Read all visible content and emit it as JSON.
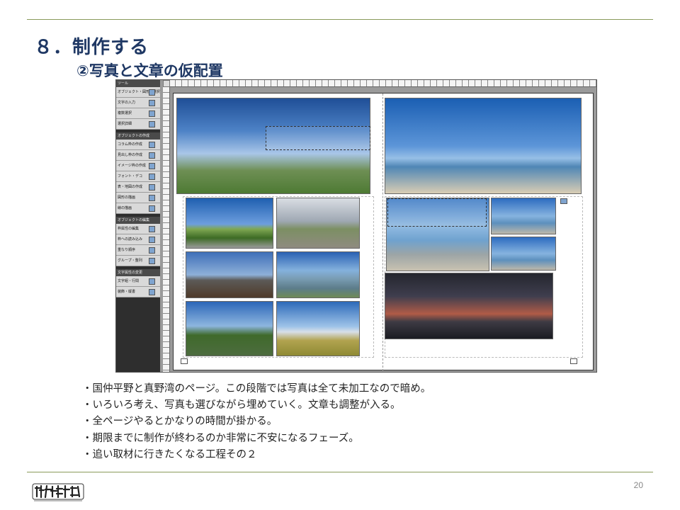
{
  "slide": {
    "title": "８．制作する",
    "subtitle": "②写真と文章の仮配置",
    "page_number": "20"
  },
  "colors": {
    "title": "#1f3864",
    "rule": "#8a9a5b",
    "text": "#222222"
  },
  "app_panel": {
    "sections": [
      {
        "header": "ツール",
        "items": [
          "オブジェクト・図形の選択",
          "文字の入力",
          "複数選択",
          "選択詳細"
        ]
      },
      {
        "header": "オブジェクトの作成",
        "items": [
          "コラム枠の作成",
          "見出し枠の作成",
          "イメージ枠の作成",
          "フォント・デコ",
          "表・地図の作成",
          "図形の描画",
          "線の描画"
        ]
      },
      {
        "header": "オブジェクトの編集",
        "items": [
          "枠属性の編集",
          "枠への読み込み",
          "重なり順序",
          "グループ・整列"
        ]
      },
      {
        "header": "文字属性の変更",
        "items": [
          "文字組・行間",
          "装飾・縦書"
        ]
      }
    ]
  },
  "spread": {
    "photos": [
      {
        "name": "photo-sky-plain",
        "fill": "sky-wide"
      },
      {
        "name": "photo-pier-sea",
        "fill": "sea-wide"
      },
      {
        "name": "photo-road-blue-sky",
        "fill": "sky-road"
      },
      {
        "name": "photo-road-cloudy",
        "fill": "cloud-road"
      },
      {
        "name": "photo-plowed-field",
        "fill": "dusk-field"
      },
      {
        "name": "photo-flooded-paddy",
        "fill": "paddy"
      },
      {
        "name": "photo-river-hills",
        "fill": "hill-river"
      },
      {
        "name": "photo-golden-field",
        "fill": "golden"
      },
      {
        "name": "photo-beach",
        "fill": "beach"
      },
      {
        "name": "photo-sea-small-1",
        "fill": "sea-small"
      },
      {
        "name": "photo-sea-small-2",
        "fill": "sea-small"
      },
      {
        "name": "photo-sunset-sea",
        "fill": "sunset"
      }
    ]
  },
  "bullets": [
    "・国仲平野と真野湾のページ。この段階では写真は全て未加工なので暗め。",
    "・いろいろ考え、写真も選びながら埋めていく。文章も調整が入る。",
    "・全ページやるとかなりの時間が掛かる。",
    "・期限までに制作が終わるのか非常に不安になるフェーズ。",
    "・追い取材に行きたくなる工程その２"
  ]
}
